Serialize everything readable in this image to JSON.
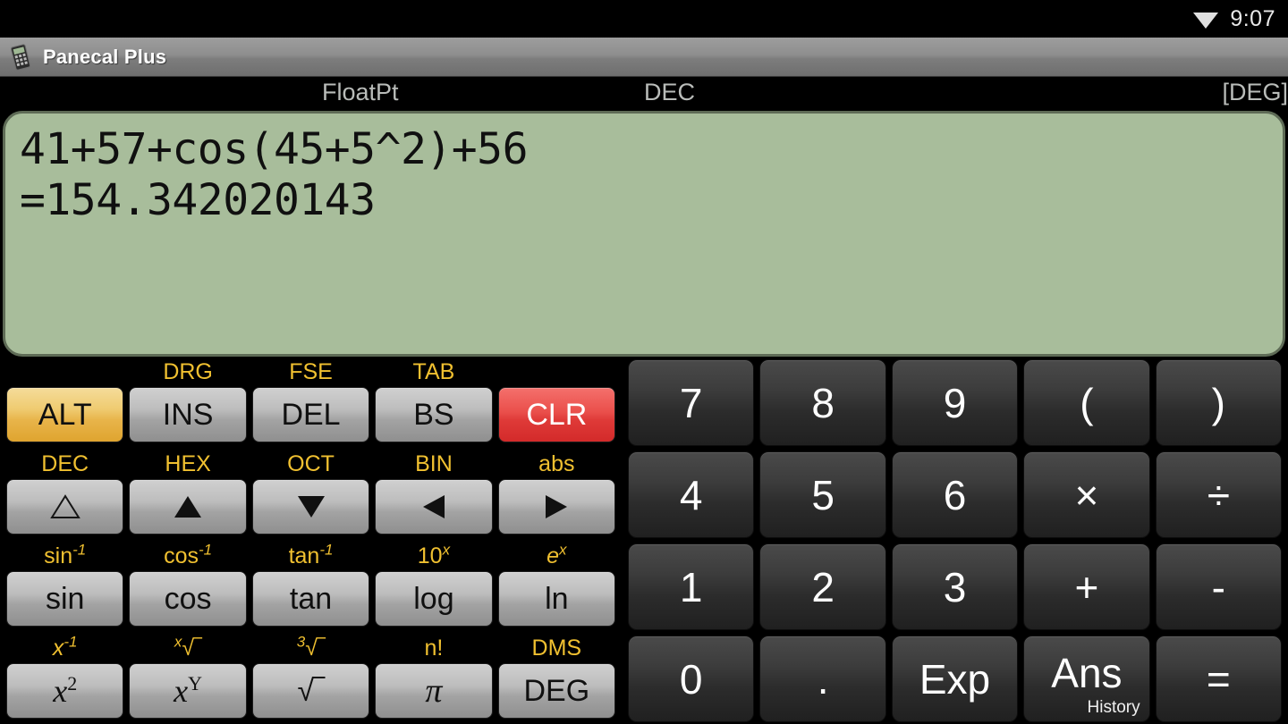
{
  "statusbar": {
    "time": "9:07",
    "wifi_icon": "wifi-icon"
  },
  "titlebar": {
    "title": "Panecal Plus",
    "icon": "calculator-icon"
  },
  "modebar": {
    "float_mode": "FloatPt",
    "radix_mode": "DEC",
    "angle_mode": "[DEG]"
  },
  "display": {
    "expression": "41+57+cos(45+5^2)+56",
    "result": "=154.342020143",
    "background_color": "#a8bd9b",
    "text_color": "#101010"
  },
  "colors": {
    "amber": "#f0c030",
    "alt_key": "#e8b44a",
    "clear_key": "#df3a38",
    "gray_key": "#bdbdbd",
    "dark_key": "#3c3c3c"
  },
  "function_pad": {
    "rows": [
      {
        "labels": [
          "",
          "DRG",
          "FSE",
          "TAB",
          ""
        ],
        "keys": [
          {
            "label": "ALT",
            "style": "amber"
          },
          {
            "label": "INS",
            "style": "gray"
          },
          {
            "label": "DEL",
            "style": "gray"
          },
          {
            "label": "BS",
            "style": "gray"
          },
          {
            "label": "CLR",
            "style": "red"
          }
        ]
      },
      {
        "labels": [
          "DEC",
          "HEX",
          "OCT",
          "BIN",
          "abs"
        ],
        "keys": [
          {
            "label": "triangle-outline-up-icon",
            "style": "gray",
            "icon": "triangle-up-outline"
          },
          {
            "label": "triangle-up-icon",
            "style": "gray",
            "icon": "triangle-up"
          },
          {
            "label": "triangle-down-icon",
            "style": "gray",
            "icon": "triangle-down"
          },
          {
            "label": "triangle-left-icon",
            "style": "gray",
            "icon": "triangle-left"
          },
          {
            "label": "triangle-right-icon",
            "style": "gray",
            "icon": "triangle-right"
          }
        ]
      },
      {
        "labels": [
          "sin-1",
          "cos-1",
          "tan-1",
          "10x",
          "ex"
        ],
        "label_html": [
          "sin<sup>-1</sup>",
          "cos<sup>-1</sup>",
          "tan<sup>-1</sup>",
          "10<sup class=\"it\">x</sup>",
          "<span class=\"it\">e</span><sup class=\"it\">x</sup>"
        ],
        "keys": [
          {
            "label": "sin",
            "style": "gray"
          },
          {
            "label": "cos",
            "style": "gray"
          },
          {
            "label": "tan",
            "style": "gray"
          },
          {
            "label": "log",
            "style": "gray"
          },
          {
            "label": "ln",
            "style": "gray"
          }
        ]
      },
      {
        "labels": [
          "x-1",
          "x-root",
          "cube-root",
          "n!",
          "DMS"
        ],
        "label_html": [
          "<span class=\"it\">x</span><sup>-1</sup>",
          "<sup class=\"it\">x</sup>√‾",
          "<sup>3</sup>√‾",
          "n!",
          "DMS"
        ],
        "keys": [
          {
            "label": "x2",
            "style": "gray",
            "html": "<span class=\"math\">x<sup>2</sup></span>"
          },
          {
            "label": "xY",
            "style": "gray",
            "html": "<span class=\"math\">x<sup>Y</sup></span>"
          },
          {
            "label": "sqrt",
            "style": "gray",
            "html": "√‾"
          },
          {
            "label": "pi",
            "style": "gray",
            "html": "<span class=\"pi\">π</span>"
          },
          {
            "label": "DEG",
            "style": "gray"
          }
        ]
      }
    ]
  },
  "numeric_pad": {
    "rows": [
      [
        {
          "label": "7"
        },
        {
          "label": "8"
        },
        {
          "label": "9"
        },
        {
          "label": "("
        },
        {
          "label": ")"
        }
      ],
      [
        {
          "label": "4"
        },
        {
          "label": "5"
        },
        {
          "label": "6"
        },
        {
          "label": "×"
        },
        {
          "label": "÷"
        }
      ],
      [
        {
          "label": "1"
        },
        {
          "label": "2"
        },
        {
          "label": "3"
        },
        {
          "label": "+"
        },
        {
          "label": "-"
        }
      ],
      [
        {
          "label": "0"
        },
        {
          "label": "."
        },
        {
          "label": "Exp"
        },
        {
          "label": "Ans",
          "sub": "History"
        },
        {
          "label": "="
        }
      ]
    ]
  }
}
